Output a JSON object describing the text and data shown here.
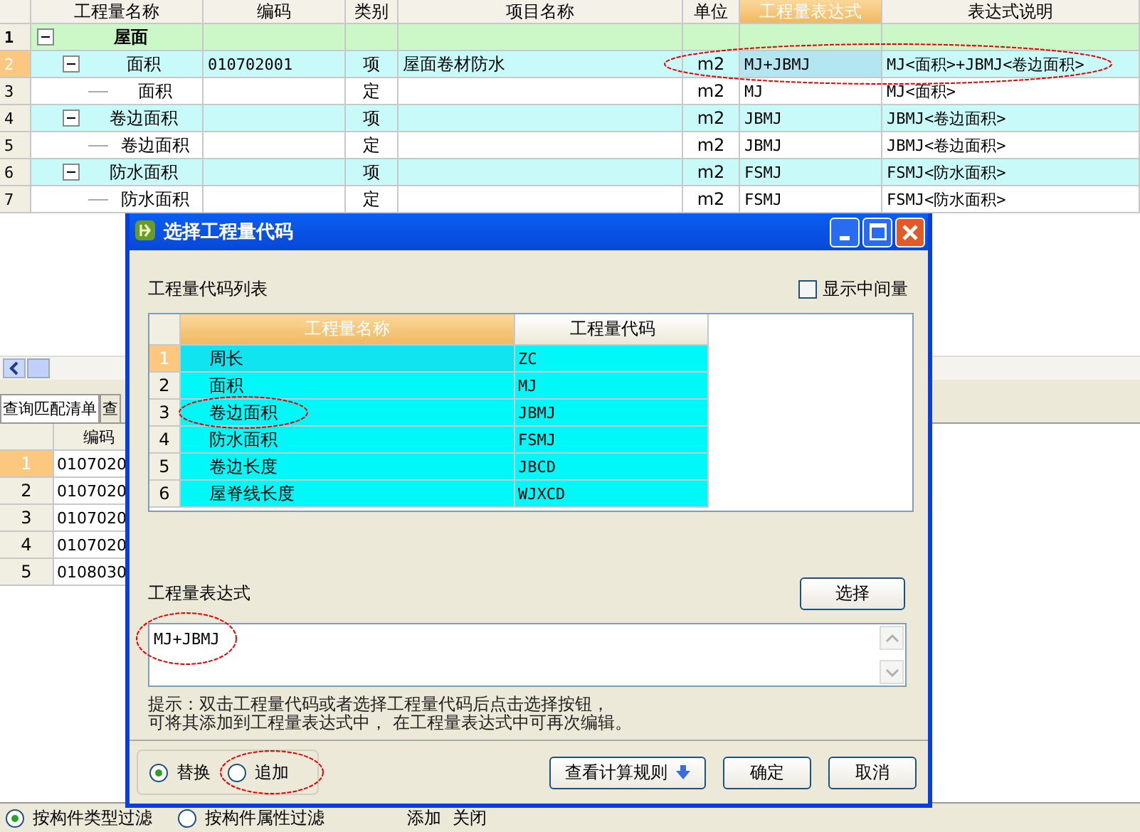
{
  "grid": {
    "columns": [
      {
        "label": "工程量名称",
        "selected": false
      },
      {
        "label": "编码",
        "selected": false
      },
      {
        "label": "类别",
        "selected": false
      },
      {
        "label": "项目名称",
        "selected": false
      },
      {
        "label": "单位",
        "selected": false
      },
      {
        "label": "工程量表达式",
        "selected": true
      },
      {
        "label": "表达式说明",
        "selected": false
      }
    ],
    "rows": [
      {
        "num": "1",
        "kind": "group",
        "name": "屋面",
        "selected": false,
        "expanded": true,
        "children": [
          {
            "num": "2",
            "kind": "item",
            "name": "面积",
            "code": "010702001",
            "type": "项",
            "project": "屋面卷材防水",
            "unit": "m2",
            "expr": "MJ+JBMJ",
            "desc": "MJ<面积>+JBMJ<卷边面积>",
            "selected": true,
            "expanded": true,
            "children": [
              {
                "num": "3",
                "kind": "quota",
                "name": "面积",
                "type": "定",
                "unit": "m2",
                "expr": "MJ",
                "desc": "MJ<面积>",
                "selected": false
              }
            ]
          },
          {
            "num": "4",
            "kind": "item",
            "name": "卷边面积",
            "type": "项",
            "unit": "m2",
            "expr": "JBMJ",
            "desc": "JBMJ<卷边面积>",
            "selected": false,
            "expanded": true,
            "children": [
              {
                "num": "5",
                "kind": "quota",
                "name": "卷边面积",
                "type": "定",
                "unit": "m2",
                "expr": "JBMJ",
                "desc": "JBMJ<卷边面积>",
                "selected": false
              }
            ]
          },
          {
            "num": "6",
            "kind": "item",
            "name": "防水面积",
            "type": "项",
            "unit": "m2",
            "expr": "FSMJ",
            "desc": "FSMJ<防水面积>",
            "selected": false,
            "expanded": true,
            "children": [
              {
                "num": "7",
                "kind": "quota",
                "name": "防水面积",
                "type": "定",
                "unit": "m2",
                "expr": "FSMJ",
                "desc": "FSMJ<防水面积>",
                "selected": false
              }
            ]
          }
        ]
      }
    ]
  },
  "tabs": [
    {
      "label": "查询匹配清单",
      "selected": true
    },
    {
      "label": "查",
      "selected": false
    }
  ],
  "lower_grid": {
    "columns": [
      "编码"
    ],
    "rows": [
      {
        "num": "1",
        "code": "0107020",
        "selected": true
      },
      {
        "num": "2",
        "code": "0107020",
        "selected": false
      },
      {
        "num": "3",
        "code": "0107020",
        "selected": false
      },
      {
        "num": "4",
        "code": "0107020",
        "selected": false
      },
      {
        "num": "5",
        "code": "0108030",
        "selected": false
      }
    ]
  },
  "dialog": {
    "title": "选择工程量代码",
    "list_label": "工程量代码列表",
    "show_intermediate": {
      "label": "显示中间量",
      "checked": false
    },
    "code_table": {
      "columns": [
        "工程量名称",
        "工程量代码"
      ],
      "rows": [
        {
          "num": "1",
          "name": "周长",
          "code": "ZC",
          "selected": true
        },
        {
          "num": "2",
          "name": "面积",
          "code": "MJ",
          "selected": false
        },
        {
          "num": "3",
          "name": "卷边面积",
          "code": "JBMJ",
          "selected": false
        },
        {
          "num": "4",
          "name": "防水面积",
          "code": "FSMJ",
          "selected": false
        },
        {
          "num": "5",
          "name": "卷边长度",
          "code": "JBCD",
          "selected": false
        },
        {
          "num": "6",
          "name": "屋脊线长度",
          "code": "WJXCD",
          "selected": false
        }
      ]
    },
    "expression_label": "工程量表达式",
    "select_button": "选择",
    "expression": "MJ+JBMJ",
    "hint": [
      "提示：双击工程量代码或者选择工程量代码后点击选择按钮，",
      "可将其添加到工程量表达式中， 在工程量表达式中可再次编辑。"
    ],
    "modes": [
      {
        "label": "替换",
        "selected": true
      },
      {
        "label": "追加",
        "selected": false
      }
    ],
    "buttons": [
      {
        "label": "查看计算规则",
        "kind": "dropdown"
      },
      {
        "label": "确定",
        "kind": "plain"
      },
      {
        "label": "取消",
        "kind": "plain"
      }
    ]
  },
  "footer": {
    "filters": [
      {
        "label": "按构件类型过滤",
        "selected": true
      },
      {
        "label": "按构件属性过滤",
        "selected": false
      }
    ],
    "actions": [
      "添加",
      "关闭"
    ]
  }
}
